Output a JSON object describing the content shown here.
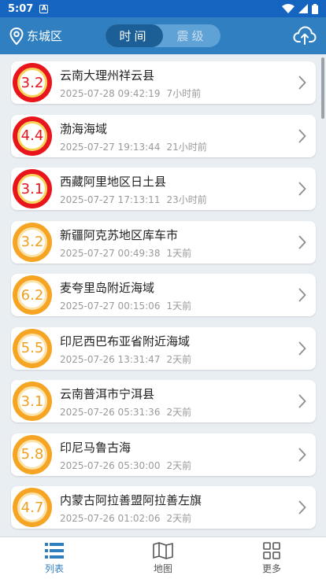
{
  "status": {
    "time": "5:07",
    "notif_letter": "A"
  },
  "header": {
    "location": "东城区",
    "tabs": [
      {
        "label": "时间",
        "active": true
      },
      {
        "label": "震级",
        "active": false
      }
    ]
  },
  "quakes": [
    {
      "mag": "3.2",
      "level": "red",
      "place": "云南大理州祥云县",
      "time": "2025-07-28 09:42:19",
      "ago": "7小时前"
    },
    {
      "mag": "4.4",
      "level": "red",
      "place": "渤海海域",
      "time": "2025-07-27 19:13:44",
      "ago": "21小时前"
    },
    {
      "mag": "3.1",
      "level": "red",
      "place": "西藏阿里地区日土县",
      "time": "2025-07-27 17:13:11",
      "ago": "23小时前"
    },
    {
      "mag": "3.2",
      "level": "orange",
      "place": "新疆阿克苏地区库车市",
      "time": "2025-07-27 00:49:38",
      "ago": "1天前"
    },
    {
      "mag": "6.2",
      "level": "orange",
      "place": "麦夸里岛附近海域",
      "time": "2025-07-27 00:15:06",
      "ago": "1天前"
    },
    {
      "mag": "5.5",
      "level": "orange",
      "place": "印尼西巴布亚省附近海域",
      "time": "2025-07-26 13:31:47",
      "ago": "2天前"
    },
    {
      "mag": "3.1",
      "level": "orange",
      "place": "云南普洱市宁洱县",
      "time": "2025-07-26 05:31:36",
      "ago": "2天前"
    },
    {
      "mag": "5.8",
      "level": "orange",
      "place": "印尼马鲁古海",
      "time": "2025-07-26 05:30:00",
      "ago": "2天前"
    },
    {
      "mag": "4.7",
      "level": "orange",
      "place": "内蒙古阿拉善盟阿拉善左旗",
      "time": "2025-07-26 01:02:06",
      "ago": "2天前"
    }
  ],
  "bottom_tabs": [
    {
      "label": "列表",
      "icon": "list-icon",
      "active": true
    },
    {
      "label": "地图",
      "icon": "map-icon",
      "active": false
    },
    {
      "label": "更多",
      "icon": "grid-icon",
      "active": false
    }
  ],
  "colors": {
    "header": "#2f7fc1",
    "statusbar": "#1565c0",
    "red": "#e8151d",
    "orange": "#f5a523"
  }
}
